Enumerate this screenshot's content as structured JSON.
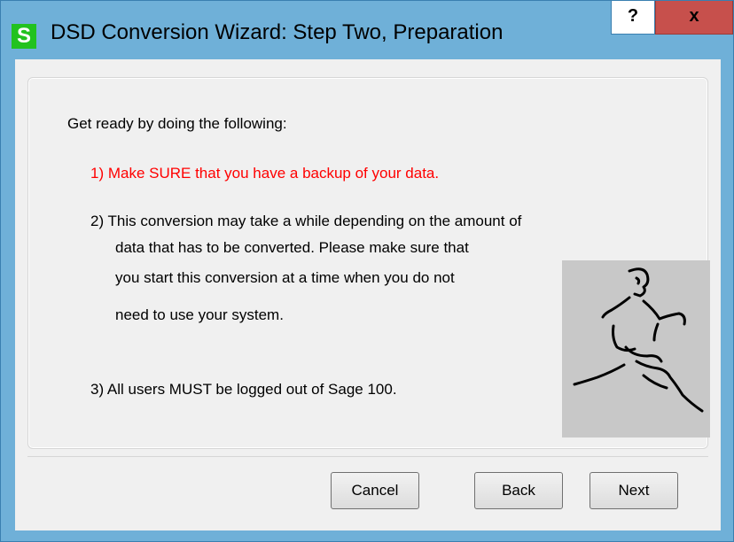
{
  "window": {
    "app_icon_letter": "S",
    "title": "DSD Conversion Wizard: Step Two, Preparation",
    "help_label": "?",
    "close_label": "x"
  },
  "content": {
    "intro": "Get ready by doing the following:",
    "step1": "1) Make SURE that you have a backup of your data.",
    "step2_lines": [
      "2) This conversion may take a while depending on the amount of",
      "data that has to be converted.  Please make sure that",
      "you start this conversion at a time when you do not",
      "need to use your system."
    ],
    "step3": "3) All users MUST be logged out of Sage 100."
  },
  "buttons": {
    "cancel": "Cancel",
    "back": "Back",
    "next": "Next"
  },
  "colors": {
    "titlebar": "#6fb0d8",
    "warning_text": "#ff0000",
    "close_button": "#c7504c",
    "app_icon": "#22c21f"
  },
  "icons": {
    "app": "sage-s-icon",
    "illustration": "running-man-icon"
  }
}
